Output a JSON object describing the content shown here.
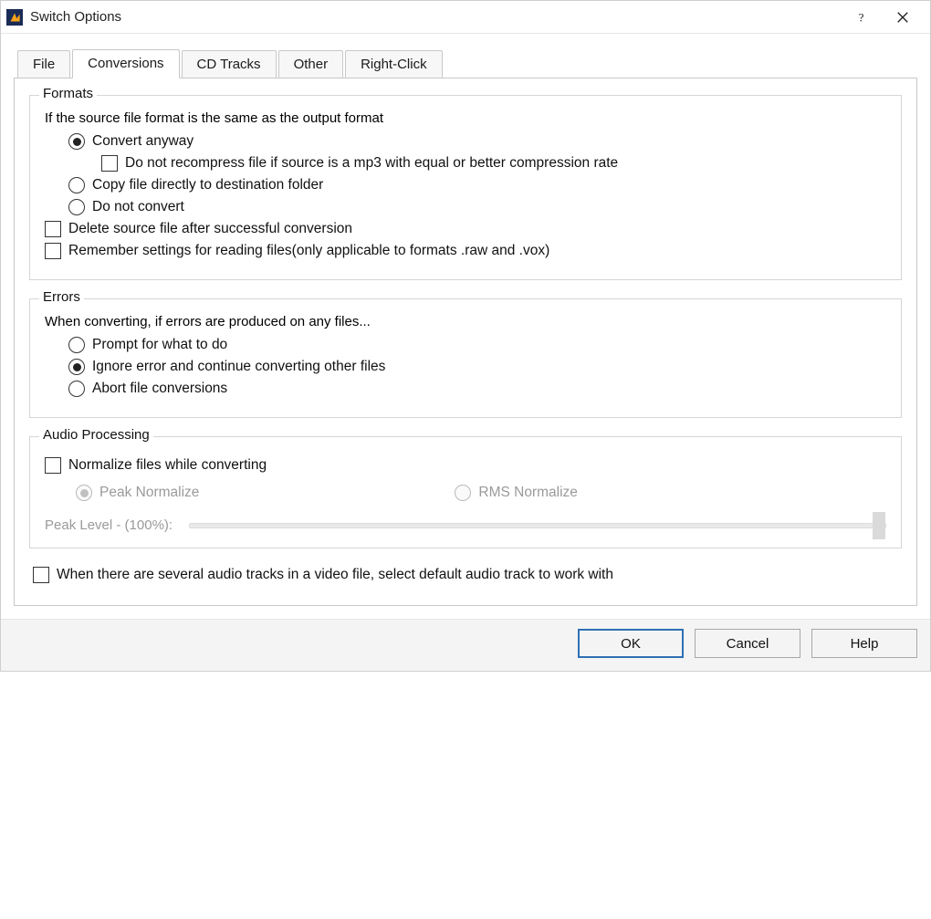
{
  "window": {
    "title": "Switch Options"
  },
  "tabs": [
    {
      "label": "File"
    },
    {
      "label": "Conversions"
    },
    {
      "label": "CD Tracks"
    },
    {
      "label": "Other"
    },
    {
      "label": "Right-Click"
    }
  ],
  "formats": {
    "legend": "Formats",
    "desc": "If the source file format is the same as the output format",
    "radio_convert_anyway": "Convert anyway",
    "check_dont_recompress": "Do not recompress file if source is a mp3 with equal or better compression rate",
    "radio_copy_to_dest": "Copy file directly to destination folder",
    "radio_do_not_convert": "Do not convert",
    "check_delete_source": "Delete source file after successful conversion",
    "check_remember_settings": "Remember settings for reading files(only applicable to formats .raw and .vox)"
  },
  "errors": {
    "legend": "Errors",
    "desc": "When converting, if errors are produced on any files...",
    "radio_prompt": "Prompt for what to do",
    "radio_ignore": "Ignore error and continue converting other files",
    "radio_abort": "Abort file conversions"
  },
  "audio": {
    "legend": "Audio Processing",
    "check_normalize": "Normalize files while converting",
    "radio_peak": "Peak Normalize",
    "radio_rms": "RMS Normalize",
    "peak_level_label": "Peak Level - (100%):"
  },
  "check_default_track": "When there are several audio tracks in a video file, select default audio track to work with",
  "buttons": {
    "ok": "OK",
    "cancel": "Cancel",
    "help": "Help"
  }
}
